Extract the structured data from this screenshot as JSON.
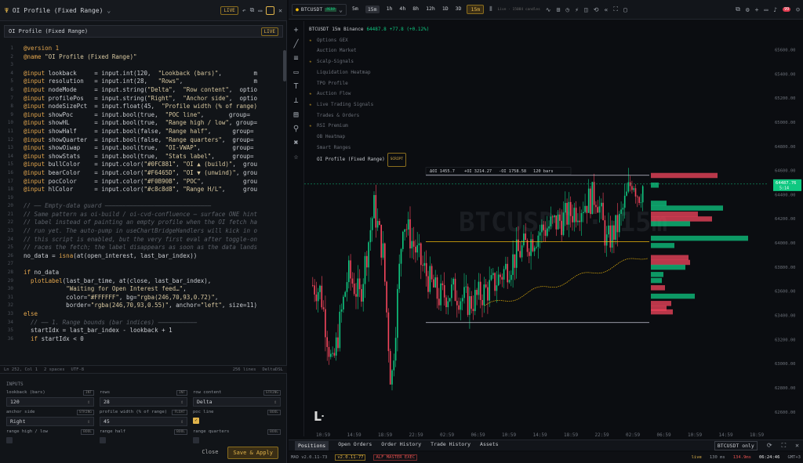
{
  "editor": {
    "title": "OI Profile (Fixed Range)",
    "live_badge": "LIVE",
    "script_name": "OI Profile (Fixed Range)",
    "script_badge": "LIVE",
    "status": {
      "pos": "Ln 252, Col 1",
      "spaces": "2 spaces",
      "enc": "UTF-8",
      "lines": "256 lines",
      "lang": "DeltaDSL"
    }
  },
  "code": [
    {
      "n": "1",
      "p": [
        [
          "kw",
          "@version 1"
        ]
      ]
    },
    {
      "n": "2",
      "p": [
        [
          "kw",
          "@name "
        ],
        [
          "st",
          "\"OI Profile (Fixed Range)\""
        ]
      ]
    },
    {
      "n": "3",
      "p": []
    },
    {
      "n": "4",
      "p": [
        [
          "kw",
          "@input "
        ],
        [
          "tx",
          "lookback     = input.int(120,  "
        ],
        [
          "st",
          "\"Lookback (bars)\""
        ],
        [
          "tx",
          ",         m"
        ]
      ]
    },
    {
      "n": "5",
      "p": [
        [
          "kw",
          "@input "
        ],
        [
          "tx",
          "resolution   = input.int(28,   "
        ],
        [
          "st",
          "\"Rows\""
        ],
        [
          "tx",
          ",                    m"
        ]
      ]
    },
    {
      "n": "6",
      "p": [
        [
          "kw",
          "@input "
        ],
        [
          "tx",
          "nodeMode     = input.string("
        ],
        [
          "st",
          "\"Delta\""
        ],
        [
          "tx",
          ",  "
        ],
        [
          "st",
          "\"Row content\""
        ],
        [
          "tx",
          ",  optio"
        ]
      ]
    },
    {
      "n": "7",
      "p": [
        [
          "kw",
          "@input "
        ],
        [
          "tx",
          "profilePos   = input.string("
        ],
        [
          "st",
          "\"Right\""
        ],
        [
          "tx",
          ",  "
        ],
        [
          "st",
          "\"Anchor side\""
        ],
        [
          "tx",
          ",  optio"
        ]
      ]
    },
    {
      "n": "8",
      "p": [
        [
          "kw",
          "@input "
        ],
        [
          "tx",
          "nodeSizePct  = input.float(45,  "
        ],
        [
          "st",
          "\"Profile width (% of range)"
        ]
      ]
    },
    {
      "n": "9",
      "p": [
        [
          "kw",
          "@input "
        ],
        [
          "tx",
          "showPoc      = input.bool(true,  "
        ],
        [
          "st",
          "\"POC line\""
        ],
        [
          "tx",
          ",       group="
        ]
      ]
    },
    {
      "n": "10",
      "p": [
        [
          "kw",
          "@input "
        ],
        [
          "tx",
          "showHL       = input.bool(true,  "
        ],
        [
          "st",
          "\"Range high / low\""
        ],
        [
          "tx",
          ", group="
        ]
      ]
    },
    {
      "n": "11",
      "p": [
        [
          "kw",
          "@input "
        ],
        [
          "tx",
          "showHalf     = input.bool(false, "
        ],
        [
          "st",
          "\"Range half\""
        ],
        [
          "tx",
          ",      group="
        ]
      ]
    },
    {
      "n": "12",
      "p": [
        [
          "kw",
          "@input "
        ],
        [
          "tx",
          "showQuarter  = input.bool(false, "
        ],
        [
          "st",
          "\"Range quarters\""
        ],
        [
          "tx",
          ",  group="
        ]
      ]
    },
    {
      "n": "13",
      "p": [
        [
          "kw",
          "@input "
        ],
        [
          "tx",
          "showOiwap    = input.bool(true,  "
        ],
        [
          "st",
          "\"OI-VWAP\""
        ],
        [
          "tx",
          ",         group="
        ]
      ]
    },
    {
      "n": "14",
      "p": [
        [
          "kw",
          "@input "
        ],
        [
          "tx",
          "showStats    = input.bool(true,  "
        ],
        [
          "st",
          "\"Stats label\""
        ],
        [
          "tx",
          ",     group="
        ]
      ]
    },
    {
      "n": "15",
      "p": [
        [
          "kw",
          "@input "
        ],
        [
          "tx",
          "bullColor    = input.color("
        ],
        [
          "st",
          "\"#0FC881\""
        ],
        [
          "tx",
          ", "
        ],
        [
          "st",
          "\"OI ▲ (build)\""
        ],
        [
          "tx",
          ",  grou"
        ]
      ]
    },
    {
      "n": "16",
      "p": [
        [
          "kw",
          "@input "
        ],
        [
          "tx",
          "bearColor    = input.color("
        ],
        [
          "st",
          "\"#F6465D\""
        ],
        [
          "tx",
          ", "
        ],
        [
          "st",
          "\"OI ▼ (unwind)\""
        ],
        [
          "tx",
          ", grou"
        ]
      ]
    },
    {
      "n": "17",
      "p": [
        [
          "kw",
          "@input "
        ],
        [
          "tx",
          "pocColor     = input.color("
        ],
        [
          "st",
          "\"#F0B90B\""
        ],
        [
          "tx",
          ", "
        ],
        [
          "st",
          "\"POC\""
        ],
        [
          "tx",
          ",           grou"
        ]
      ]
    },
    {
      "n": "18",
      "p": [
        [
          "kw",
          "@input "
        ],
        [
          "tx",
          "hlColor      = input.color("
        ],
        [
          "st",
          "\"#c8c8d8\""
        ],
        [
          "tx",
          ", "
        ],
        [
          "st",
          "\"Range H/L\""
        ],
        [
          "tx",
          ",     grou"
        ]
      ]
    },
    {
      "n": "19",
      "p": []
    },
    {
      "n": "20",
      "p": [
        [
          "cm",
          "// —— Empty-data guard ——————————————————————————————"
        ]
      ]
    },
    {
      "n": "21",
      "p": [
        [
          "cm",
          "// Same pattern as oi-build / oi-cvd-confluence — surface ONE hint"
        ]
      ]
    },
    {
      "n": "22",
      "p": [
        [
          "cm",
          "// label instead of painting an empty profile when the OI fetch ha"
        ]
      ]
    },
    {
      "n": "23",
      "p": [
        [
          "cm",
          "// run yet. The auto-pump in useChartBridgeHandlers will kick in o"
        ]
      ]
    },
    {
      "n": "24",
      "p": [
        [
          "cm",
          "// this script is enabled, but the very first eval after toggle-on"
        ]
      ]
    },
    {
      "n": "25",
      "p": [
        [
          "cm",
          "// races the fetch; the label disappears as soon as the data lands"
        ]
      ]
    },
    {
      "n": "26",
      "p": [
        [
          "tx",
          "no_data = "
        ],
        [
          "kw",
          "isna"
        ],
        [
          "tx",
          "(at(open_interest, last_bar_index))"
        ]
      ]
    },
    {
      "n": "27",
      "p": []
    },
    {
      "n": "28",
      "p": [
        [
          "kw",
          "if "
        ],
        [
          "tx",
          "no_data"
        ]
      ]
    },
    {
      "n": "29",
      "p": [
        [
          "tx",
          "  "
        ],
        [
          "kw",
          "plotLabel"
        ],
        [
          "tx",
          "(last_bar_time, at(close, last_bar_index),"
        ]
      ]
    },
    {
      "n": "30",
      "p": [
        [
          "tx",
          "            "
        ],
        [
          "st",
          "\"Waiting for Open Interest feed…\""
        ],
        [
          "tx",
          ","
        ]
      ]
    },
    {
      "n": "31",
      "p": [
        [
          "tx",
          "            color="
        ],
        [
          "st",
          "\"#FFFFFF\""
        ],
        [
          "tx",
          ", bg="
        ],
        [
          "st",
          "\"rgba(246,70,93,0.72)\""
        ],
        [
          "tx",
          ","
        ]
      ]
    },
    {
      "n": "32",
      "p": [
        [
          "tx",
          "            border="
        ],
        [
          "st",
          "\"rgba(246,70,93,0.55)\""
        ],
        [
          "tx",
          ", anchor="
        ],
        [
          "st",
          "\"left\""
        ],
        [
          "tx",
          ", size=11)"
        ]
      ]
    },
    {
      "n": "33",
      "p": [
        [
          "kw",
          "else"
        ]
      ]
    },
    {
      "n": "34",
      "p": [
        [
          "cm",
          "  // —— 1. Range bounds (bar indices) ———————————"
        ]
      ]
    },
    {
      "n": "35",
      "p": [
        [
          "tx",
          "  startIdx = last_bar_index - lookback + 1"
        ]
      ]
    },
    {
      "n": "36",
      "p": [
        [
          "kw",
          "  if "
        ],
        [
          "tx",
          "startIdx < 0"
        ]
      ]
    }
  ],
  "inputs": {
    "title": "INPUTS",
    "fields": [
      {
        "label": "lookback (bars)",
        "type": "INT",
        "value": "120",
        "col": 0,
        "row": 0
      },
      {
        "label": "rows",
        "type": "INT",
        "value": "28",
        "col": 1,
        "row": 0
      },
      {
        "label": "row content",
        "type": "STRING",
        "value": "Delta",
        "col": 2,
        "row": 0
      },
      {
        "label": "anchor side",
        "type": "STRING",
        "value": "Right",
        "col": 0,
        "row": 1
      },
      {
        "label": "profile width (% of range)",
        "type": "FLOAT",
        "value": "45",
        "col": 1,
        "row": 1
      },
      {
        "label": "poc line",
        "type": "BOOL",
        "value": "✓",
        "col": 2,
        "row": 1
      },
      {
        "label": "range high / low",
        "type": "BOOL",
        "value": "",
        "col": 0,
        "row": 2
      },
      {
        "label": "range half",
        "type": "BOOL",
        "value": "",
        "col": 1,
        "row": 2
      },
      {
        "label": "range quarters",
        "type": "BOOL",
        "value": "",
        "col": 2,
        "row": 2
      }
    ],
    "close_label": "Close",
    "apply_label": "Save & Apply"
  },
  "toolbar": {
    "symbol": "BTCUSDT",
    "perp": "PERP",
    "timeframes": [
      "5m",
      "15m",
      "1h",
      "4h",
      "8h",
      "12h",
      "1D",
      "3D"
    ],
    "active_tf": "15m",
    "tf_select": "15m",
    "live": "Live · 15084 candles",
    "notif": "99"
  },
  "chart": {
    "symbol": "BTCUSDT",
    "interval": "15m",
    "exchange": "Binance",
    "price": "64487.8",
    "change": "+77.8 (+0.12%)",
    "watermark": "BTCUSDT · 15m",
    "indicators": [
      "Options GEX",
      "Auction Market",
      "Scalp-Signals",
      "Liquidation Heatmap",
      "TPO Profile",
      "Auction Flow",
      "Live Trading Signals",
      "Trades & Orders",
      "RSI Premium",
      "OB Heatmap",
      "Smart Ranges",
      "OI Profile (Fixed Range)"
    ],
    "script_badge": "SCRIPT",
    "stats": [
      "ΔOI 1455.7",
      "+OI 3214.27",
      "-OI 1758.58",
      "120 bars"
    ],
    "price_tag": "64487.76",
    "price_time": "5:14",
    "y_ticks": [
      "65600.00",
      "65400.00",
      "65200.00",
      "65000.00",
      "64800.00",
      "64600.00",
      "64400.00",
      "64200.00",
      "64000.00",
      "63800.00",
      "63600.00",
      "63400.00",
      "63200.00",
      "63000.00",
      "62800.00",
      "62600.00"
    ],
    "x_ticks": [
      "10:59",
      "14:59",
      "18:59",
      "22:59",
      "02:59",
      "06:59",
      "10:59",
      "14:59",
      "18:59",
      "22:59",
      "02:59",
      "06:59",
      "10:59",
      "14:59",
      "18:59"
    ],
    "colors": {
      "bull": "#0FC881",
      "bear": "#F6465D",
      "poc": "#F0B90B",
      "hl": "#c8c8d8"
    },
    "ylim": [
      62540,
      65720
    ],
    "range_high": 64560,
    "range_low": 63340,
    "poc": 64010
  },
  "bottom_tabs": [
    "Positions",
    "Open Orders",
    "Order History",
    "Trade History",
    "Assets"
  ],
  "bottom_right": "BTCUSDT only",
  "statusbar": {
    "version": "MAD v2.0.11-73",
    "ver2": "v2.0.11-77",
    "alf": "ALF MASTER EXEC",
    "live": "live",
    "ms": "130 ms",
    "time": "06:24:46",
    "gmt": "GMT+3",
    "open": "134.9ms"
  }
}
